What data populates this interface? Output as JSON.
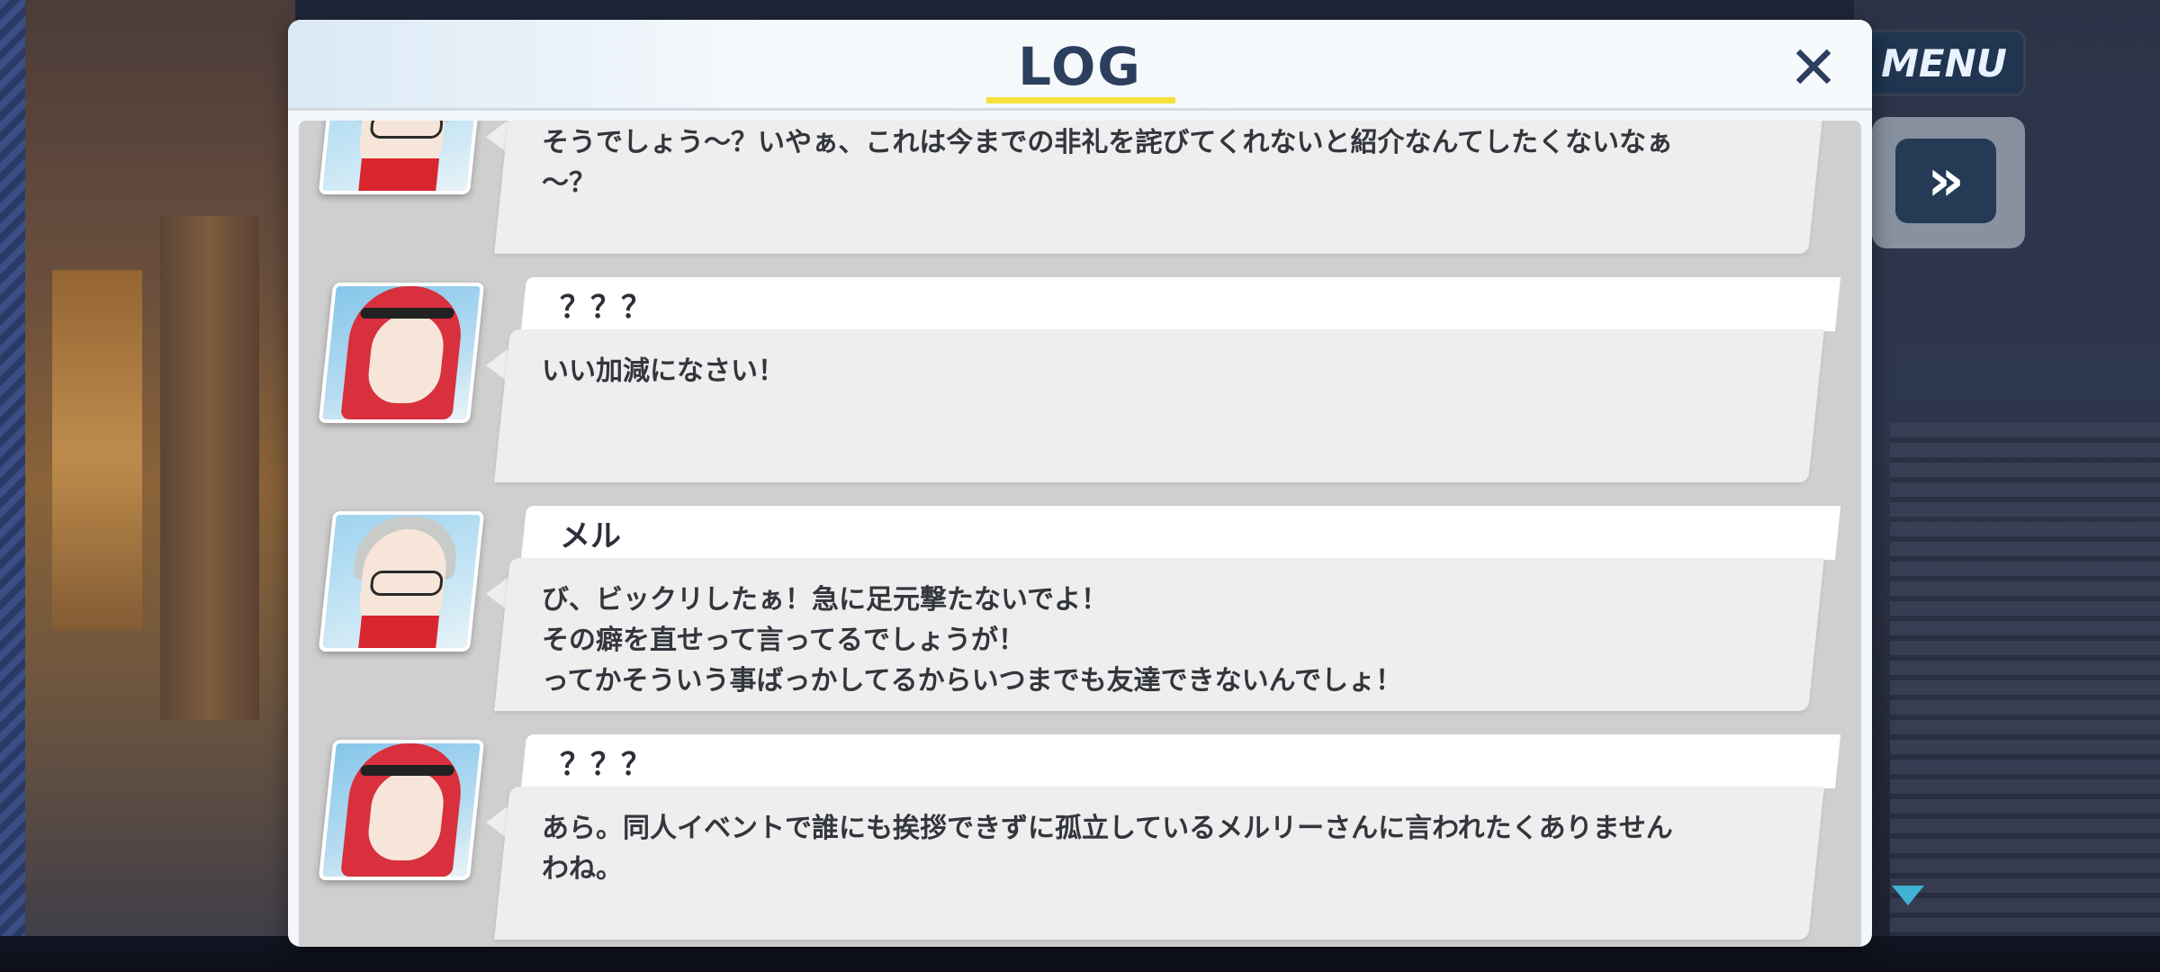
{
  "window": {
    "title": "LOG",
    "close_symbol": "✕"
  },
  "hud": {
    "menu_label": "MENU",
    "skip_symbol": "»"
  },
  "log": {
    "entries": [
      {
        "speaker": "",
        "avatar": "mel-avatar",
        "text": "そうでしょう～？いやぁ、これは今までの非礼を詫びてくれないと紹介なんてしたくないなぁ\n～？"
      },
      {
        "speaker": "？？？",
        "avatar": "red-hair-girl-avatar",
        "text": "いい加減になさい！"
      },
      {
        "speaker": "メル",
        "avatar": "mel-avatar",
        "text": "び、ビックリしたぁ！急に足元撃たないでよ！\nその癖を直せって言ってるでしょうが！\nってかそういう事ばっかしてるからいつまでも友達できないんでしょ！"
      },
      {
        "speaker": "？？？",
        "avatar": "red-hair-girl-avatar",
        "text": "あら。同人イベントで誰にも挨拶できずに孤立しているメルリーさんに言われたくありません\nわね。"
      }
    ]
  },
  "colors": {
    "title": "#2c3f5e",
    "underline": "#f2e23a",
    "bubble": "#eeeeee",
    "log_bg": "#cfcfcf"
  }
}
